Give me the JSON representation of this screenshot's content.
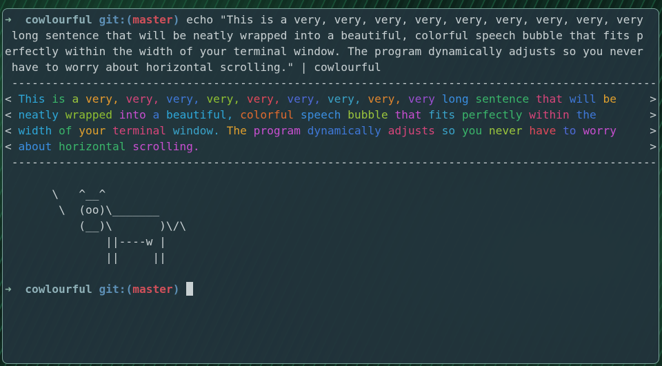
{
  "prompt": {
    "arrow": "➜",
    "dir": "cowlourful",
    "git": "git:(",
    "branch": "master",
    "git_close": ")"
  },
  "command_lines": [
    " echo \"This is a very, very, very, very, very, very, very, very, very",
    " long sentence that will be neatly wrapped into a beautiful, colorful speech bubble that fits p",
    "erfectly within the width of your terminal window. The program dynamically adjusts so you never",
    " have to worry about horizontal scrolling.\" | cowlourful"
  ],
  "bubble_border": " ------------------------------------------------------------------------------------------------",
  "bubble": {
    "open": "<",
    "close": ">",
    "lines": [
      [
        {
          "t": "This",
          "c": "#2ea7d8"
        },
        {
          "t": "is",
          "c": "#3ab56a"
        },
        {
          "t": "a",
          "c": "#9bc53d"
        },
        {
          "t": "very,",
          "c": "#e69a2e"
        },
        {
          "t": "very,",
          "c": "#d7457a"
        },
        {
          "t": "very,",
          "c": "#3f78d8"
        },
        {
          "t": "very,",
          "c": "#8fbf32"
        },
        {
          "t": "very,",
          "c": "#e0495a"
        },
        {
          "t": "very,",
          "c": "#4f6ad8"
        },
        {
          "t": "very,",
          "c": "#3aa3c9"
        },
        {
          "t": "very,",
          "c": "#e0862e"
        },
        {
          "t": "very",
          "c": "#9a4fd0"
        },
        {
          "t": "long",
          "c": "#3a8ee0"
        },
        {
          "t": "sentence",
          "c": "#3ab56a"
        },
        {
          "t": "that",
          "c": "#d7457a"
        },
        {
          "t": "will",
          "c": "#3f78d8"
        },
        {
          "t": "be",
          "c": "#e0a02e"
        }
      ],
      [
        {
          "t": "neatly",
          "c": "#2ea7d8"
        },
        {
          "t": "wrapped",
          "c": "#8fbf32"
        },
        {
          "t": "into",
          "c": "#c84fd0"
        },
        {
          "t": "a",
          "c": "#3f78d8"
        },
        {
          "t": "beautiful,",
          "c": "#2ea7d8"
        },
        {
          "t": "colorful",
          "c": "#e06a2e"
        },
        {
          "t": "speech",
          "c": "#3a8ee0"
        },
        {
          "t": "bubble",
          "c": "#9bc53d"
        },
        {
          "t": "that",
          "c": "#c84fd0"
        },
        {
          "t": "fits",
          "c": "#3aa3c9"
        },
        {
          "t": "perfectly",
          "c": "#3ab56a"
        },
        {
          "t": "within",
          "c": "#d7457a"
        },
        {
          "t": "the",
          "c": "#3f78d8"
        }
      ],
      [
        {
          "t": "width",
          "c": "#2ea7d8"
        },
        {
          "t": "of",
          "c": "#3ab56a"
        },
        {
          "t": "your",
          "c": "#e0a02e"
        },
        {
          "t": "terminal",
          "c": "#d7457a"
        },
        {
          "t": "window.",
          "c": "#3aa3c9"
        },
        {
          "t": "The",
          "c": "#e0a02e"
        },
        {
          "t": "program",
          "c": "#c84fd0"
        },
        {
          "t": "dynamically",
          "c": "#3f78d8"
        },
        {
          "t": "adjusts",
          "c": "#d7457a"
        },
        {
          "t": "so",
          "c": "#3aa3c9"
        },
        {
          "t": "you",
          "c": "#3ab56a"
        },
        {
          "t": "never",
          "c": "#9bc53d"
        },
        {
          "t": "have",
          "c": "#e0495a"
        },
        {
          "t": "to",
          "c": "#4f6ad8"
        },
        {
          "t": "worry",
          "c": "#c84fd0"
        }
      ],
      [
        {
          "t": "about",
          "c": "#3a8ee0"
        },
        {
          "t": "horizontal",
          "c": "#3ab56a"
        },
        {
          "t": "scrolling.",
          "c": "#c84fd0"
        }
      ]
    ]
  },
  "cow_lines": [
    "",
    "       \\   ^__^",
    "        \\  (oo)\\_______",
    "           (__)\\       )\\/\\",
    "               ||----w |",
    "               ||     ||",
    ""
  ]
}
